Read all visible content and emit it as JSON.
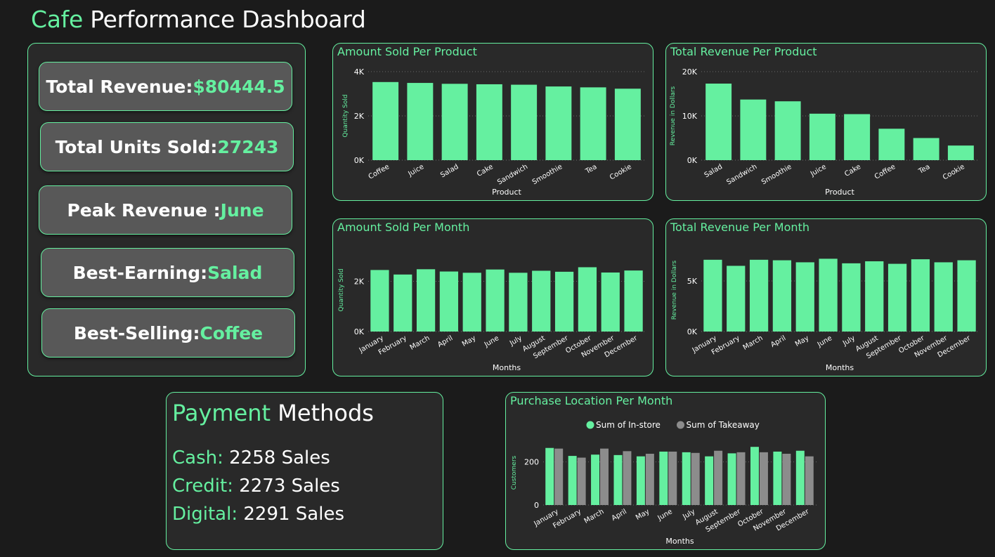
{
  "header": {
    "title_accent": "Cafe",
    "title_rest": "Performance Dashboard"
  },
  "kpis": [
    {
      "label": "Total Revenue: ",
      "value": "$80444.5"
    },
    {
      "label": "Total Units Sold: ",
      "value": "27243"
    },
    {
      "label": "Peak Revenue : ",
      "value": "June"
    },
    {
      "label": "Best-Earning: ",
      "value": "Salad"
    },
    {
      "label": "Best-Selling: ",
      "value": "Coffee"
    }
  ],
  "payment": {
    "title_accent": "Payment",
    "title_rest": "Methods",
    "rows": [
      {
        "label": "Cash:",
        "value": "2258 Sales"
      },
      {
        "label": "Credit:",
        "value": "2273 Sales"
      },
      {
        "label": "Digital:",
        "value": "2291 Sales"
      }
    ]
  },
  "colors": {
    "accent": "#65f0a0",
    "secondary": "#8c8c8c",
    "panel": "#292929",
    "background": "#1b1b1b"
  },
  "chart_data": [
    {
      "id": "amount-sold-product",
      "type": "bar",
      "title": "Amount Sold Per Product",
      "xlabel": "Product",
      "ylabel": "Quantity Sold",
      "categories": [
        "Coffee",
        "Juice",
        "Salad",
        "Cake",
        "Sandwich",
        "Smoothie",
        "Tea",
        "Cookie"
      ],
      "series": [
        {
          "values": [
            3530,
            3490,
            3450,
            3430,
            3410,
            3330,
            3290,
            3230
          ]
        }
      ],
      "ylim": [
        0,
        4000
      ],
      "yticks": [
        0,
        2000,
        4000
      ],
      "ytick_labels": [
        "0K",
        "2K",
        "4K"
      ],
      "grid": true
    },
    {
      "id": "revenue-product",
      "type": "bar",
      "title": "Total Revenue Per Product",
      "xlabel": "Product",
      "ylabel": "Revenue in Dollars",
      "categories": [
        "Salad",
        "Sandwich",
        "Smoothie",
        "Juice",
        "Cake",
        "Coffee",
        "Tea",
        "Cookie"
      ],
      "series": [
        {
          "values": [
            17300,
            13700,
            13300,
            10500,
            10400,
            7100,
            5000,
            3300
          ]
        }
      ],
      "ylim": [
        0,
        20000
      ],
      "yticks": [
        0,
        10000,
        20000
      ],
      "ytick_labels": [
        "0K",
        "10K",
        "20K"
      ],
      "grid": true
    },
    {
      "id": "amount-sold-month",
      "type": "bar",
      "title": "Amount Sold Per Month",
      "xlabel": "Months",
      "ylabel": "Quantity Sold",
      "categories": [
        "January",
        "February",
        "March",
        "April",
        "May",
        "June",
        "July",
        "August",
        "September",
        "October",
        "November",
        "December"
      ],
      "series": [
        {
          "values": [
            2450,
            2270,
            2480,
            2390,
            2340,
            2470,
            2340,
            2420,
            2380,
            2560,
            2350,
            2430
          ]
        }
      ],
      "ylim": [
        0,
        3300
      ],
      "yticks": [
        0,
        2000
      ],
      "ytick_labels": [
        "0K",
        "2K"
      ],
      "grid": true
    },
    {
      "id": "revenue-month",
      "type": "bar",
      "title": "Total Revenue Per Month",
      "xlabel": "Months",
      "ylabel": "Revenue in Dollars",
      "categories": [
        "January",
        "February",
        "March",
        "April",
        "May",
        "June",
        "July",
        "August",
        "September",
        "October",
        "November",
        "December"
      ],
      "series": [
        {
          "values": [
            7100,
            6500,
            7100,
            7050,
            6850,
            7200,
            6750,
            6950,
            6700,
            7150,
            6850,
            7050
          ]
        }
      ],
      "ylim": [
        0,
        8200
      ],
      "yticks": [
        0,
        5000
      ],
      "ytick_labels": [
        "0K",
        "5K"
      ],
      "grid": true
    },
    {
      "id": "purchase-location",
      "type": "bar",
      "title": "Purchase Location Per Month",
      "xlabel": "Months",
      "ylabel": "Customers",
      "legend": "top-center",
      "categories": [
        "January",
        "February",
        "March",
        "April",
        "May",
        "June",
        "July",
        "August",
        "September",
        "October",
        "November",
        "December"
      ],
      "series": [
        {
          "name": "Sum of In-store",
          "color": "#65f0a0",
          "values": [
            265,
            228,
            234,
            232,
            226,
            248,
            245,
            226,
            240,
            270,
            248,
            252
          ]
        },
        {
          "name": "Sum of Takeaway",
          "color": "#8c8c8c",
          "values": [
            262,
            220,
            262,
            250,
            238,
            248,
            242,
            252,
            245,
            245,
            238,
            226
          ]
        }
      ],
      "ylim": [
        0,
        300
      ],
      "yticks": [
        0,
        200
      ],
      "ytick_labels": [
        "0",
        "200"
      ],
      "grid": true
    }
  ]
}
